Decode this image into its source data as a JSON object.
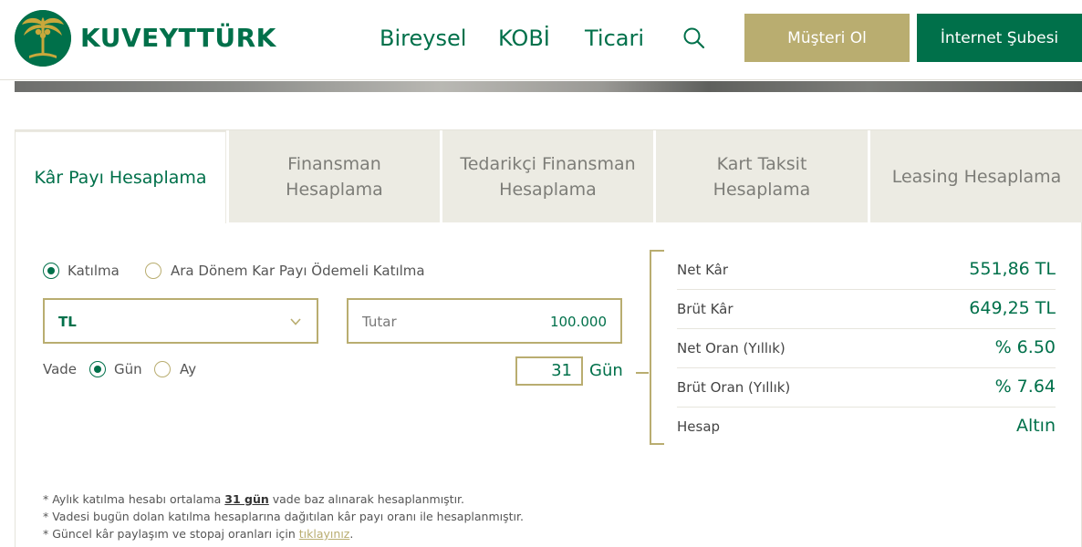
{
  "header": {
    "brand": "KUVEYTTÜRK",
    "nav": [
      "Bireysel",
      "KOBİ",
      "Ticari"
    ],
    "musteri_ol": "Müşteri Ol",
    "internet_subesi": "İnternet Şubesi"
  },
  "tabs": [
    "Kâr Payı Hesaplama",
    "Finansman Hesaplama",
    "Tedarikçi Finansman Hesaplama",
    "Kart Taksit Hesaplama",
    "Leasing Hesaplama"
  ],
  "form": {
    "account_type_options": [
      "Katılma",
      "Ara Dönem Kar Payı Ödemeli Katılma"
    ],
    "account_type_selected": "Katılma",
    "currency": "TL",
    "amount_label": "Tutar",
    "amount_value": "100.000",
    "term_label": "Vade",
    "term_options": [
      "Gün",
      "Ay"
    ],
    "term_selected": "Gün",
    "days_value": "31",
    "days_unit": "Gün"
  },
  "results": [
    {
      "label": "Net Kâr",
      "value": "551,86 TL"
    },
    {
      "label": "Brüt Kâr",
      "value": "649,25 TL"
    },
    {
      "label": "Net Oran (Yıllık)",
      "value": "% 6.50"
    },
    {
      "label": "Brüt Oran (Yıllık)",
      "value": "% 7.64"
    },
    {
      "label": "Hesap",
      "value": "Altın"
    }
  ],
  "notes": {
    "n1_pre": "* Aylık katılma hesabı ortalama ",
    "n1_bold": "31 gün",
    "n1_post": " vade baz alınarak hesaplanmıştır.",
    "n2": "* Vadesi bugün dolan katılma hesaplarına dağıtılan kâr payı oranı ile hesaplanmıştır.",
    "n3_pre": "* Güncel kâr paylaşım ve stopaj oranları için ",
    "n3_link": "tıklayınız",
    "n3_post": "."
  },
  "colors": {
    "primary_green": "#00704a",
    "gold": "#b9ad70",
    "tab_bg": "#ecebe3"
  },
  "icons": {
    "logo": "palm-tree-logo-icon",
    "search": "search-icon",
    "dropdown": "chevron-down-icon"
  }
}
